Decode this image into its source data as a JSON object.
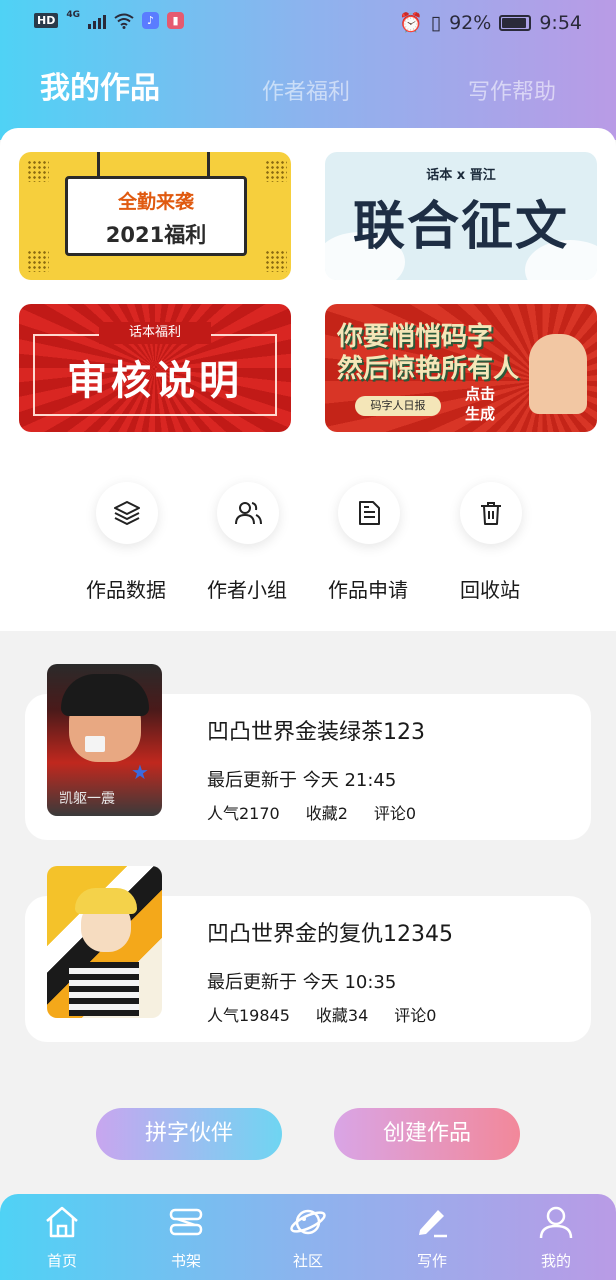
{
  "status_bar": {
    "hd": "HD",
    "network": "4G",
    "alarm_icon": "alarm-icon",
    "vibrate_icon": "vibrate-icon",
    "battery": "92%",
    "time": "9:54"
  },
  "header": {
    "tabs": [
      {
        "label": "我的作品",
        "active": true
      },
      {
        "label": "作者福利",
        "active": false
      },
      {
        "label": "写作帮助",
        "active": false
      }
    ]
  },
  "banners": [
    {
      "name": "attendance",
      "line1": "全勤来袭",
      "line2": "2021福利"
    },
    {
      "name": "joint-contest",
      "subtitle": "话本 x 晋江",
      "title": "联合征文"
    },
    {
      "name": "review-notes",
      "tag": "话本福利",
      "title": "审核说明"
    },
    {
      "name": "daily-report",
      "line1": "你要悄悄码字",
      "line2": "然后惊艳所有人",
      "pill": "码字人日报",
      "cta": "点击\n生成"
    }
  ],
  "actions": [
    {
      "label": "作品数据",
      "icon": "layers-icon"
    },
    {
      "label": "作者小组",
      "icon": "users-icon"
    },
    {
      "label": "作品申请",
      "icon": "document-icon"
    },
    {
      "label": "回收站",
      "icon": "trash-icon"
    }
  ],
  "works": [
    {
      "title": "凹凸世界金装绿茶123",
      "updated": "最后更新于 今天 21:45",
      "popularity": "人气2170",
      "favorites": "收藏2",
      "comments": "评论0",
      "cover_text": "凯躯一震"
    },
    {
      "title": "凹凸世界金的复仇12345",
      "updated": "最后更新于 今天 10:35",
      "popularity": "人气19845",
      "favorites": "收藏34",
      "comments": "评论0"
    }
  ],
  "buttons": {
    "partner": "拼字伙伴",
    "create": "创建作品"
  },
  "bottom_nav": [
    {
      "label": "首页",
      "icon": "home-icon"
    },
    {
      "label": "书架",
      "icon": "bookshelf-icon"
    },
    {
      "label": "社区",
      "icon": "planet-icon"
    },
    {
      "label": "写作",
      "icon": "pen-icon"
    },
    {
      "label": "我的",
      "icon": "user-icon"
    }
  ],
  "colors": {
    "header_gradient_start": "#4fd2f5",
    "header_gradient_end": "#b99be6",
    "partner_button_start": "#c8a6ef",
    "partner_button_end": "#6fd5f2",
    "create_button_start": "#d9a5e6",
    "create_button_end": "#f2889a"
  }
}
